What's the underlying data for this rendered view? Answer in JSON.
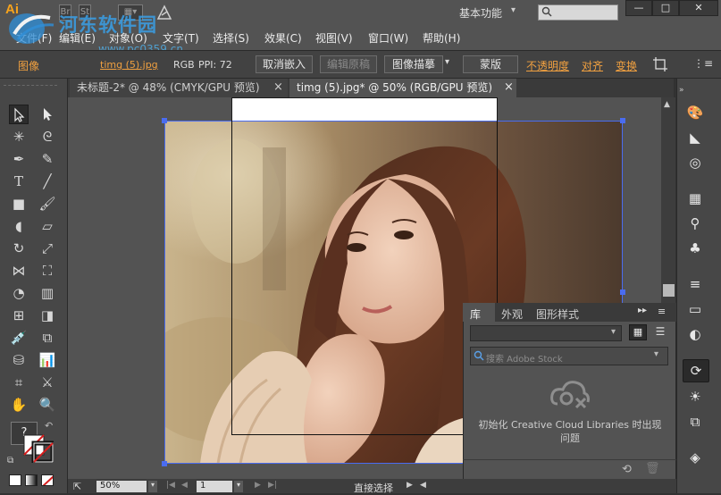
{
  "app": {
    "logo": "Ai",
    "workspace": "基本功能",
    "window_controls": [
      "—",
      "□",
      "✕"
    ]
  },
  "watermark": {
    "title": "河东软件园",
    "url": "www.pc0359.cn"
  },
  "menu": [
    "文件(F)",
    "编辑(E)",
    "对象(O)",
    "文字(T)",
    "选择(S)",
    "效果(C)",
    "视图(V)",
    "窗口(W)",
    "帮助(H)"
  ],
  "control_bar": {
    "mode_label": "图像",
    "file_link": "timg (5).jpg",
    "color_mode": "RGB",
    "ppi": "PPI: 72",
    "unembed": "取消嵌入",
    "edit_original": "编辑原稿",
    "image_trace": "图像描摹",
    "mask": "蒙版",
    "opacity": "不透明度",
    "align": "对齐",
    "transform": "变换"
  },
  "tabs": [
    {
      "label": "未标题-2* @ 48% (CMYK/GPU 预览)",
      "active": false
    },
    {
      "label": "timg (5).jpg* @ 50% (RGB/GPU 预览)",
      "active": true
    }
  ],
  "tab_close": "×",
  "library_panel": {
    "tabs": [
      "库",
      "外观",
      "图形样式"
    ],
    "search_placeholder": "搜索 Adobe Stock",
    "message": "初始化 Creative Cloud Libraries 时出现问题"
  },
  "status_bar": {
    "zoom": "50%",
    "page": "1",
    "tool_name": "直接选择"
  },
  "left_tools": {
    "help": "?"
  },
  "colors": {
    "accent_link": "#f0a040",
    "panel_bg": "#535353",
    "canvas_bg": "#535353",
    "selection_blue": "#4a6cf0"
  }
}
